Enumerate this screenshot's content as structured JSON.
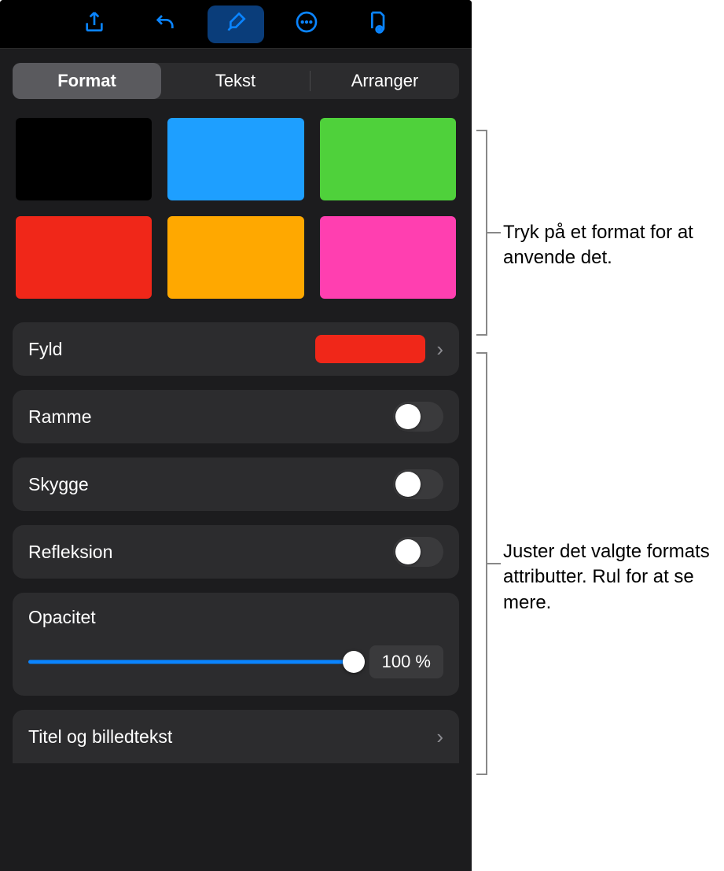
{
  "toolbar": {
    "icons": [
      "share",
      "undo",
      "brush",
      "more",
      "present"
    ]
  },
  "tabs": [
    "Format",
    "Tekst",
    "Arranger"
  ],
  "active_tab": 0,
  "swatches": [
    "#000000",
    "#1e9fff",
    "#4fd13b",
    "#f02719",
    "#ffa800",
    "#ff3fb0"
  ],
  "rows": {
    "fill": {
      "label": "Fyld",
      "color": "#f02719"
    },
    "ramme": {
      "label": "Ramme",
      "on": false
    },
    "skygge": {
      "label": "Skygge",
      "on": false
    },
    "refleksion": {
      "label": "Refleksion",
      "on": false
    },
    "opacity": {
      "label": "Opacitet",
      "value_pct": 100,
      "value_text": "100 %"
    },
    "caption": {
      "label": "Titel og billedtekst"
    }
  },
  "callouts": {
    "top": "Tryk på et format for at anvende det.",
    "bottom": "Juster det valgte formats attributter. Rul for at se mere."
  }
}
